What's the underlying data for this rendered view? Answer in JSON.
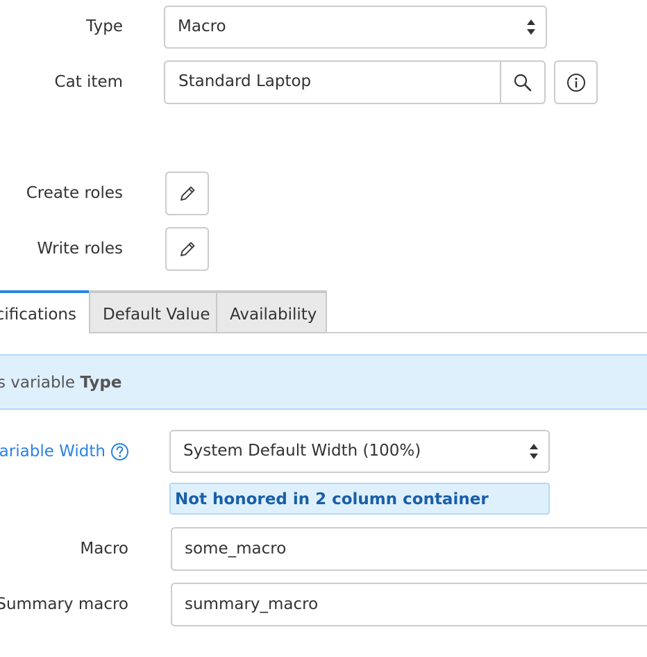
{
  "fields": {
    "type": {
      "label": "Type",
      "value": "Macro"
    },
    "cat_item": {
      "label": "Cat item",
      "value": "Standard Laptop"
    },
    "create_roles": {
      "label": "Create roles"
    },
    "write_roles": {
      "label": "Write roles"
    }
  },
  "tabs": [
    {
      "label": "cifications",
      "active": true
    },
    {
      "label": "Default Value",
      "active": false
    },
    {
      "label": "Availability",
      "active": false
    }
  ],
  "banner": {
    "prefix": "s variable ",
    "bold": "Type"
  },
  "variable_width": {
    "label": "Variable Width",
    "value": "System Default Width (100%)",
    "note": "Not honored in 2 column container"
  },
  "macro": {
    "label": "Macro",
    "value": "some_macro"
  },
  "summary_macro": {
    "label": "Summary macro",
    "value": "summary_macro"
  },
  "colors": {
    "accent": "#2b83e4",
    "banner_bg": "#dff0fd",
    "note_text": "#1a5fa8"
  },
  "icons": [
    "select-arrows-icon",
    "search-icon",
    "info-icon",
    "pencil-icon",
    "help-icon"
  ]
}
